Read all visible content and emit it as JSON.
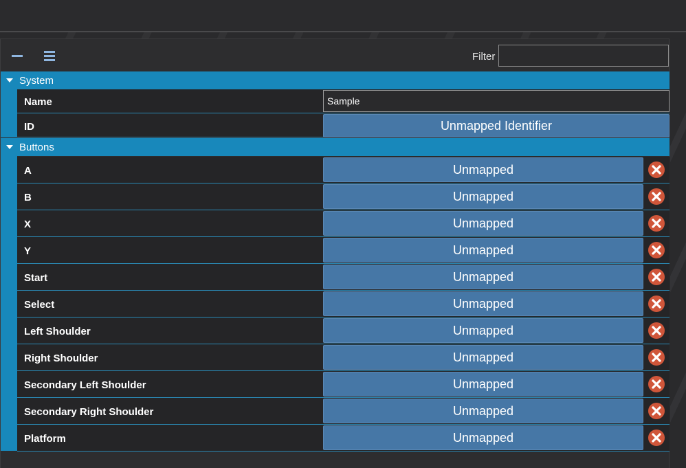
{
  "toolbar": {
    "collapse_icon": "collapse-all-icon",
    "expand_icon": "expand-all-icon",
    "filter_label": "Filter",
    "filter_value": ""
  },
  "sections": {
    "system": {
      "label": "System",
      "rows": {
        "name": {
          "label": "Name",
          "value": "Sample"
        },
        "id": {
          "label": "ID",
          "value": "Unmapped Identifier"
        }
      }
    },
    "buttons": {
      "label": "Buttons",
      "rows": [
        {
          "label": "A",
          "value": "Unmapped"
        },
        {
          "label": "B",
          "value": "Unmapped"
        },
        {
          "label": "X",
          "value": "Unmapped"
        },
        {
          "label": "Y",
          "value": "Unmapped"
        },
        {
          "label": "Start",
          "value": "Unmapped"
        },
        {
          "label": "Select",
          "value": "Unmapped"
        },
        {
          "label": "Left Shoulder",
          "value": "Unmapped"
        },
        {
          "label": "Right Shoulder",
          "value": "Unmapped"
        },
        {
          "label": "Secondary Left Shoulder",
          "value": "Unmapped"
        },
        {
          "label": "Secondary Right Shoulder",
          "value": "Unmapped"
        },
        {
          "label": "Platform",
          "value": "Unmapped"
        }
      ]
    }
  },
  "colors": {
    "section_header": "#1888bb",
    "mapping_button": "#4677a6",
    "clear_icon": "#d0563a"
  }
}
